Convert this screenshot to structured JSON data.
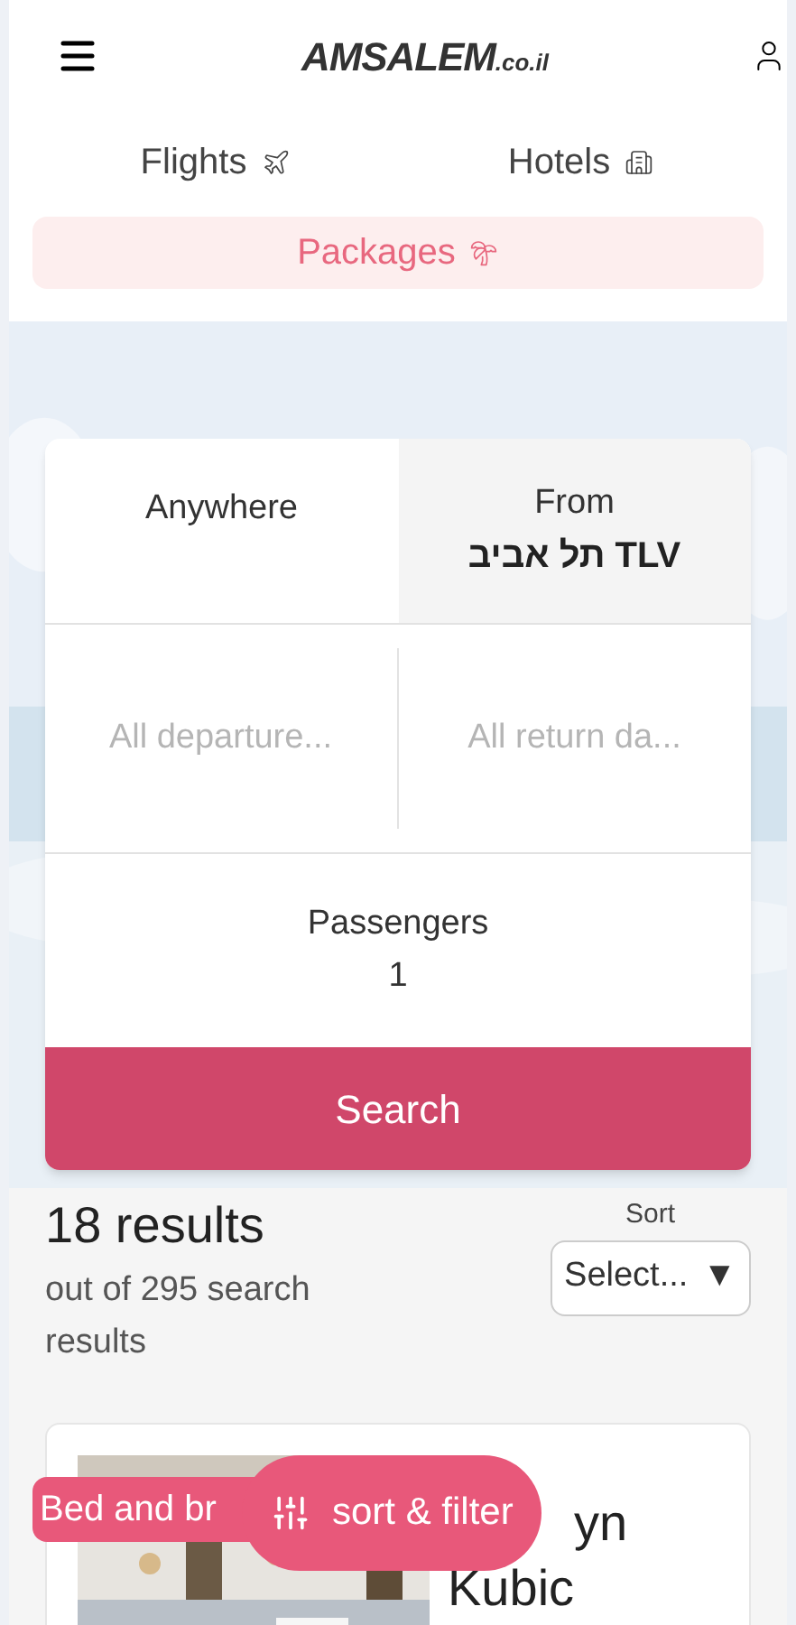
{
  "header": {
    "logo": "AMSALEM",
    "logo_suffix": ".co.il"
  },
  "nav": [
    {
      "label": "Flights",
      "selected": false,
      "kind": "plane"
    },
    {
      "label": "Hotels",
      "selected": false,
      "kind": "building"
    },
    {
      "label": "Packages",
      "selected": true,
      "kind": "palm"
    }
  ],
  "search": {
    "destination": "Anywhere",
    "origin_label": "From",
    "origin": "תל אביב TLV",
    "departure_placeholder": "All departure...",
    "return_placeholder": "All return da...",
    "passengers_label": "Passengers",
    "passengers": "1",
    "button": "Search"
  },
  "results": {
    "count": "18 results",
    "subtitle": "out of 295 search results",
    "sort_label": "Sort",
    "sort_value": "Select...",
    "sort_caret": "▼"
  },
  "result_card": {
    "kind": "picture",
    "badge": "Bed and br",
    "title_lines": [
      "yn",
      "Kubic"
    ]
  },
  "sort_filter_button": "sort & filter"
}
